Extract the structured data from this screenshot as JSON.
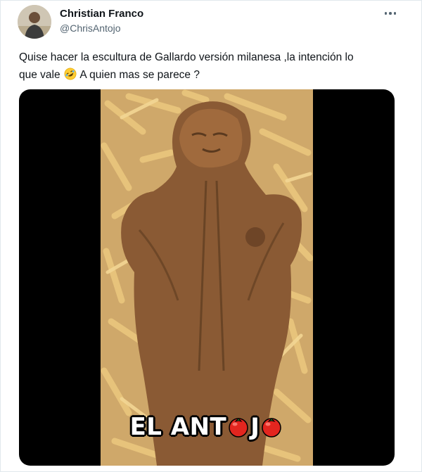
{
  "author": {
    "name": "Christian Franco",
    "handle": "@ChrisAntojo"
  },
  "tweet": {
    "text_line1": "Quise hacer la escultura de Gallardo versión milanesa ,la intención lo",
    "text_line2_a": "que vale",
    "text_line2_b": "A quien mas se parece ?"
  },
  "media": {
    "caption_a": "EL ANT",
    "caption_b": "J"
  },
  "icons": {
    "more": "more-horizontal-icon",
    "emoji": "rolling-on-floor-laughing-emoji",
    "caption_o": "tomato-emoji"
  },
  "colors": {
    "text": "#0f1419",
    "secondary": "#536471",
    "fries": "#e8c27a",
    "milanesa": "#8a5a34"
  }
}
